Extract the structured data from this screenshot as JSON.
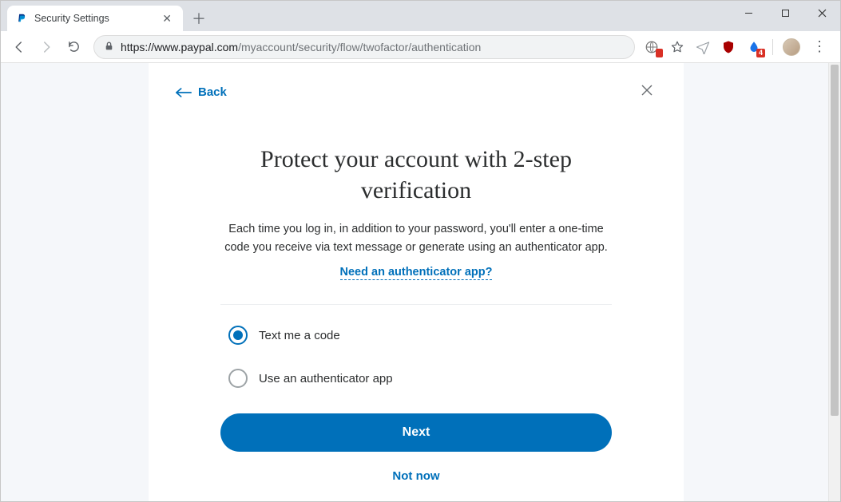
{
  "browser": {
    "tab_title": "Security Settings",
    "url_host": "https://www.paypal.com",
    "url_path": "/myaccount/security/flow/twofactor/authentication",
    "ext_badge": "4"
  },
  "panel": {
    "back_label": "Back",
    "heading": "Protect your account with 2-step verification",
    "subtext": "Each time you log in, in addition to your password, you'll enter a one-time code you receive via text message or generate using an authenticator app.",
    "help_link": "Need an authenticator app?",
    "options": [
      {
        "label": "Text me a code",
        "selected": true
      },
      {
        "label": "Use an authenticator app",
        "selected": false
      }
    ],
    "primary_button": "Next",
    "secondary_link": "Not now"
  }
}
